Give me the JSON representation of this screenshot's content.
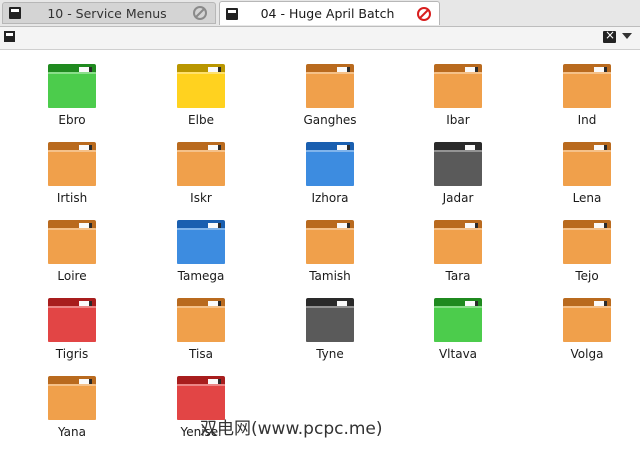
{
  "tabs": [
    {
      "label": "10 - Service Menus",
      "state": "inactive"
    },
    {
      "label": "04 - Huge April Batch",
      "state": "active"
    }
  ],
  "colors": {
    "orange": {
      "back": "#b96a1e",
      "front": "#f0a04b"
    },
    "green": {
      "back": "#1f8a1f",
      "front": "#4ccc4c"
    },
    "yellow": {
      "back": "#b99600",
      "front": "#ffd21f"
    },
    "blue": {
      "back": "#1a5fb0",
      "front": "#3d8ce0"
    },
    "dark": {
      "back": "#2a2a2a",
      "front": "#5a5a5a"
    },
    "red": {
      "back": "#a81d1d",
      "front": "#e24545"
    }
  },
  "folders": [
    {
      "label": "Ebro",
      "color": "green"
    },
    {
      "label": "Elbe",
      "color": "yellow"
    },
    {
      "label": "Ganghes",
      "color": "orange"
    },
    {
      "label": "Ibar",
      "color": "orange"
    },
    {
      "label": "Ind",
      "color": "orange"
    },
    {
      "label": "Irtish",
      "color": "orange"
    },
    {
      "label": "Iskr",
      "color": "orange"
    },
    {
      "label": "Izhora",
      "color": "blue"
    },
    {
      "label": "Jadar",
      "color": "dark"
    },
    {
      "label": "Lena",
      "color": "orange"
    },
    {
      "label": "Loire",
      "color": "orange"
    },
    {
      "label": "Tamega",
      "color": "blue"
    },
    {
      "label": "Tamish",
      "color": "orange"
    },
    {
      "label": "Tara",
      "color": "orange"
    },
    {
      "label": "Tejo",
      "color": "orange"
    },
    {
      "label": "Tigris",
      "color": "red"
    },
    {
      "label": "Tisa",
      "color": "orange"
    },
    {
      "label": "Tyne",
      "color": "dark"
    },
    {
      "label": "Vltava",
      "color": "green"
    },
    {
      "label": "Volga",
      "color": "orange"
    },
    {
      "label": "Yana",
      "color": "orange"
    },
    {
      "label": "Yenisei",
      "color": "red"
    }
  ],
  "watermark": "双电网(www.pcpc.me)"
}
